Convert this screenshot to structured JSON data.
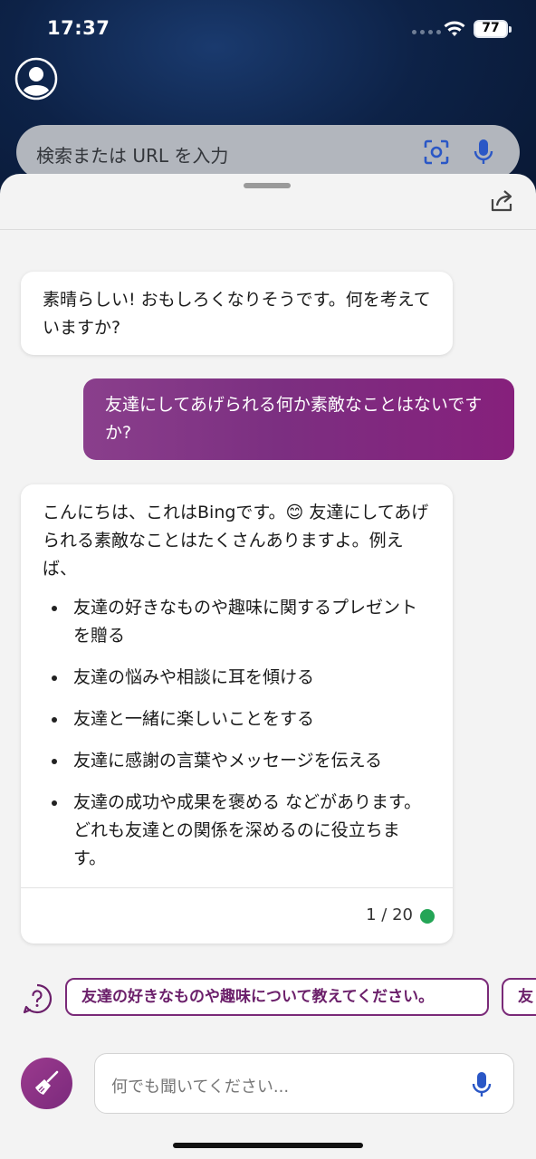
{
  "status_bar": {
    "time": "17:37",
    "battery": "77"
  },
  "browser": {
    "search_placeholder": "検索または URL を入力"
  },
  "chat": {
    "messages": [
      {
        "role": "assistant",
        "text": "素晴らしい! おもしろくなりそうです。何を考えていますか?"
      },
      {
        "role": "user",
        "text": "友達にしてあげられる何か素敵なことはないですか?"
      },
      {
        "role": "assistant",
        "intro": "こんにちは、これはBingです。😊 友達にしてあげられる素敵なことはたくさんありますよ。例えば、",
        "items": [
          "友達の好きなものや趣味に関するプレゼントを贈る",
          "友達の悩みや相談に耳を傾ける",
          "友達と一緒に楽しいことをする",
          "友達に感謝の言葉やメッセージを伝える",
          "友達の成功や成果を褒める などがあります。どれも友達との関係を深めるのに役立ちます。"
        ],
        "turn_counter": "1 / 20"
      }
    ],
    "suggestions": [
      "友達の好きなものや趣味について教えてください。",
      "友"
    ],
    "input_placeholder": "何でも聞いてください..."
  },
  "colors": {
    "accent": "#7c2f81",
    "status_dot": "#24a556"
  },
  "icons": [
    "profile-icon",
    "visual-search-icon",
    "microphone-icon",
    "share-icon",
    "help-icon",
    "new-topic-broom-icon"
  ]
}
